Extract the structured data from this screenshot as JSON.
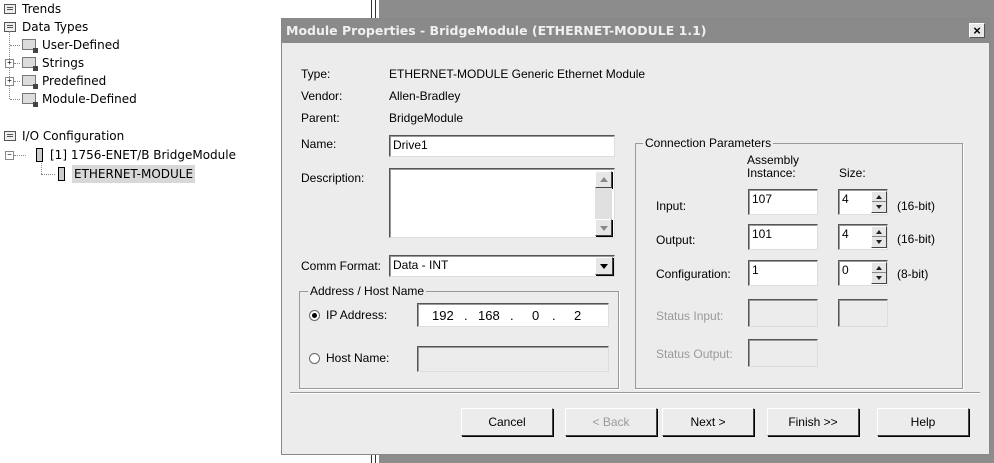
{
  "tree": {
    "items": [
      {
        "label": "Trends"
      },
      {
        "label": "Data Types"
      },
      {
        "label": "User-Defined"
      },
      {
        "label": "Strings"
      },
      {
        "label": "Predefined"
      },
      {
        "label": "Module-Defined"
      },
      {
        "label": "I/O Configuration"
      },
      {
        "label": "[1] 1756-ENET/B BridgeModule"
      },
      {
        "label": "ETHERNET-MODULE"
      }
    ]
  },
  "dialog": {
    "title": "Module Properties - BridgeModule (ETHERNET-MODULE 1.1)",
    "close": "×",
    "type_label": "Type:",
    "type_value": "ETHERNET-MODULE Generic Ethernet Module",
    "vendor_label": "Vendor:",
    "vendor_value": "Allen-Bradley",
    "parent_label": "Parent:",
    "parent_value": "BridgeModule",
    "name_label": "Name:",
    "name_value": "Drive1",
    "description_label": "Description:",
    "description_value": "",
    "comm_format_label": "Comm Format:",
    "comm_format_value": "Data - INT",
    "address_group": {
      "title": "Address / Host Name",
      "ip_label": "IP Address:",
      "ip_octets": [
        "192",
        "168",
        "0",
        "2"
      ],
      "host_label": "Host Name:",
      "host_value": ""
    },
    "connection": {
      "title": "Connection Parameters",
      "assembly_header_1": "Assembly",
      "assembly_header_2": "Instance:",
      "size_header": "Size:",
      "rows": [
        {
          "label": "Input:",
          "instance": "107",
          "size": "4",
          "unit": "(16-bit)"
        },
        {
          "label": "Output:",
          "instance": "101",
          "size": "4",
          "unit": "(16-bit)"
        },
        {
          "label": "Configuration:",
          "instance": "1",
          "size": "0",
          "unit": "(8-bit)"
        }
      ],
      "status_input_label": "Status Input:",
      "status_output_label": "Status Output:"
    },
    "buttons": {
      "cancel": "Cancel",
      "back": "< Back",
      "next": "Next >",
      "finish": "Finish >>",
      "help": "Help"
    }
  }
}
